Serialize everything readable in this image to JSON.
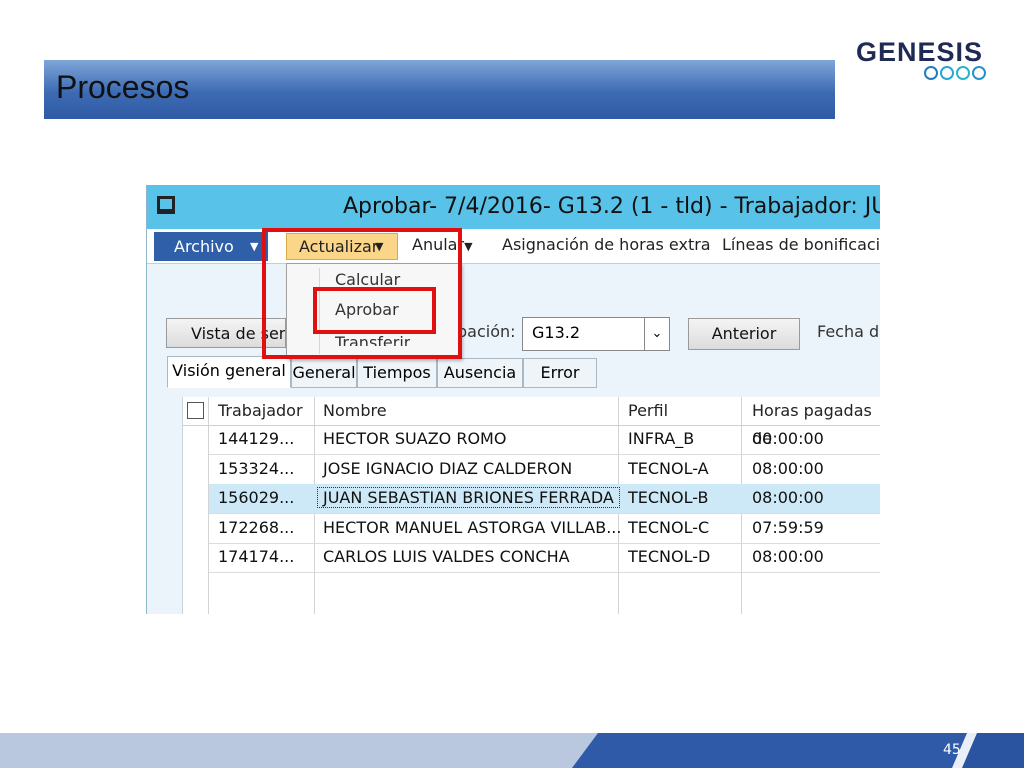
{
  "slide": {
    "title": "Procesos",
    "logo_text": "GENESIS",
    "logo_ring_colors": [
      "#1f7bc4",
      "#28a6d8",
      "#28b4c8",
      "#2a8fd0"
    ],
    "page_number": "45"
  },
  "window": {
    "caption": "Aprobar- 7/4/2016- G13.2 (1 - tld) - Trabajador: JUAN SEB",
    "menu": {
      "archivo": "Archivo",
      "actualizar": "Actualizar",
      "anular": "Anular",
      "asignacion": "Asignación de horas extra",
      "lineas": "Líneas de bonificacio"
    },
    "dropdown": [
      "Calcular",
      "Aprobar",
      "Transferir"
    ],
    "toolbar": {
      "vista_button": "Vista de sem",
      "agrupacion_label": "pación:",
      "agrupacion_value": "G13.2",
      "anterior_button": "Anterior",
      "fecha_label": "Fecha de"
    },
    "tabs": [
      "Visión general",
      "General",
      "Tiempos",
      "Ausencia",
      "Error"
    ],
    "grid": {
      "columns": [
        "Trabajador",
        "Nombre",
        "Perfil",
        "Horas pagadas de"
      ],
      "rows": [
        {
          "trabajador": "144129...",
          "nombre": "HECTOR SUAZO  ROMO",
          "perfil": "INFRA_B",
          "horas": "00:00:00"
        },
        {
          "trabajador": "153324...",
          "nombre": "JOSE IGNACIO DIAZ CALDERON",
          "perfil": "TECNOL-A",
          "horas": "08:00:00"
        },
        {
          "trabajador": "156029...",
          "nombre": "JUAN SEBASTIAN BRIONES FERRADA",
          "perfil": "TECNOL-B",
          "horas": "08:00:00"
        },
        {
          "trabajador": "172268...",
          "nombre": "HECTOR MANUEL ASTORGA  VILLAB...",
          "perfil": "TECNOL-C",
          "horas": "07:59:59"
        },
        {
          "trabajador": "174174...",
          "nombre": "CARLOS LUIS VALDES  CONCHA",
          "perfil": "TECNOL-D",
          "horas": "08:00:00"
        }
      ]
    }
  }
}
